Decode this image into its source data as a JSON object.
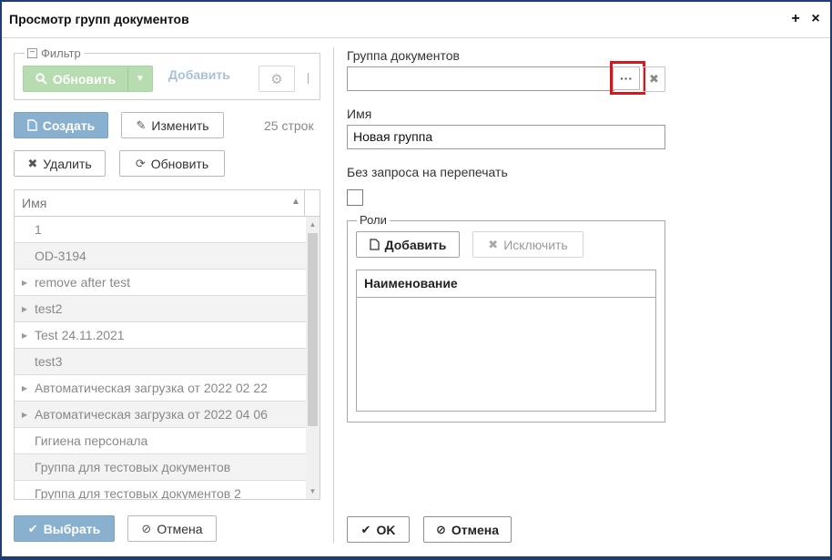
{
  "window": {
    "title": "Просмотр групп документов",
    "maximize_glyph": "+",
    "close_glyph": "×"
  },
  "filter": {
    "legend": "Фильтр",
    "collapse_glyph": "−",
    "refresh_label": "Обновить",
    "add_label": "Добавить"
  },
  "left_toolbar": {
    "create_label": "Создать",
    "edit_label": "Изменить",
    "row_count": "25 строк",
    "delete_label": "Удалить",
    "refresh_label": "Обновить"
  },
  "grid": {
    "column_name": "Имя",
    "rows": [
      {
        "expandable": false,
        "label": "1"
      },
      {
        "expandable": false,
        "label": "OD-3194"
      },
      {
        "expandable": true,
        "label": "remove after test"
      },
      {
        "expandable": true,
        "label": "test2"
      },
      {
        "expandable": true,
        "label": "Test 24.11.2021"
      },
      {
        "expandable": false,
        "label": "test3"
      },
      {
        "expandable": true,
        "label": "Автоматическая загрузка от 2022 02 22"
      },
      {
        "expandable": true,
        "label": "Автоматическая загрузка от 2022 04 06"
      },
      {
        "expandable": false,
        "label": "Гигиена персонала"
      },
      {
        "expandable": false,
        "label": "Группа для тестовых документов"
      },
      {
        "expandable": false,
        "label": "Группа для тестовых документов 2"
      }
    ]
  },
  "left_footer": {
    "select_label": "Выбрать",
    "cancel_label": "Отмена"
  },
  "form": {
    "group_label": "Группа документов",
    "group_value": "",
    "dots_glyph": "···",
    "name_label": "Имя",
    "name_value": "Новая группа",
    "noreprint_label": "Без запроса на перепечать",
    "noreprint_checked": false
  },
  "roles": {
    "legend": "Роли",
    "add_label": "Добавить",
    "exclude_label": "Исключить",
    "column_name": "Наименование",
    "rows": []
  },
  "right_footer": {
    "ok_label": "OK",
    "cancel_label": "Отмена"
  },
  "colors": {
    "primary": "#8ab0d0",
    "success_disabled": "#b6dcb0",
    "highlight": "#d9161c",
    "frame": "#1f3d73"
  }
}
